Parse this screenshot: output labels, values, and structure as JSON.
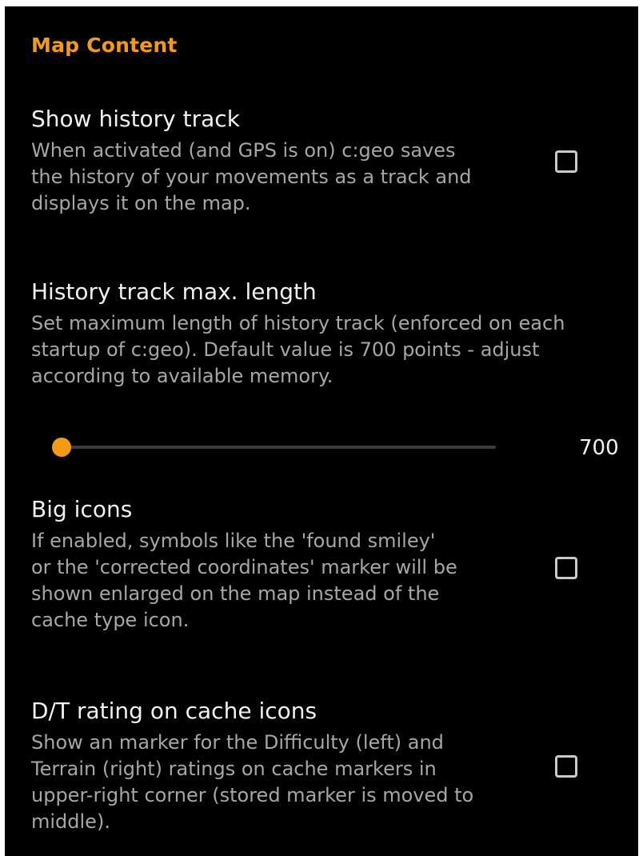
{
  "category": {
    "title": "Map Content"
  },
  "accent_color": "#f39c12",
  "preferences": [
    {
      "title": "Show history track",
      "summary": "When activated (and GPS is on) c:geo saves\nthe history of your movements as a track and\ndisplays it on the map.",
      "checked": false
    },
    {
      "title": "History track max. length",
      "summary": "Set maximum length of history track (enforced on each\nstartup of c:geo). Default value is 700 points - adjust\naccording to available memory.",
      "slider_value": "700",
      "slider_fraction": 0.0
    },
    {
      "title": "Big icons",
      "summary": "If enabled, symbols like the 'found smiley'\nor the 'corrected coordinates' marker will be\nshown enlarged on the map instead of the\ncache type icon.",
      "checked": false
    },
    {
      "title": "D/T rating on cache icons",
      "summary": "Show an marker for the Difficulty (left) and\nTerrain (right) ratings on cache markers in\nupper-right corner (stored marker is moved to\nmiddle).",
      "checked": false
    }
  ]
}
